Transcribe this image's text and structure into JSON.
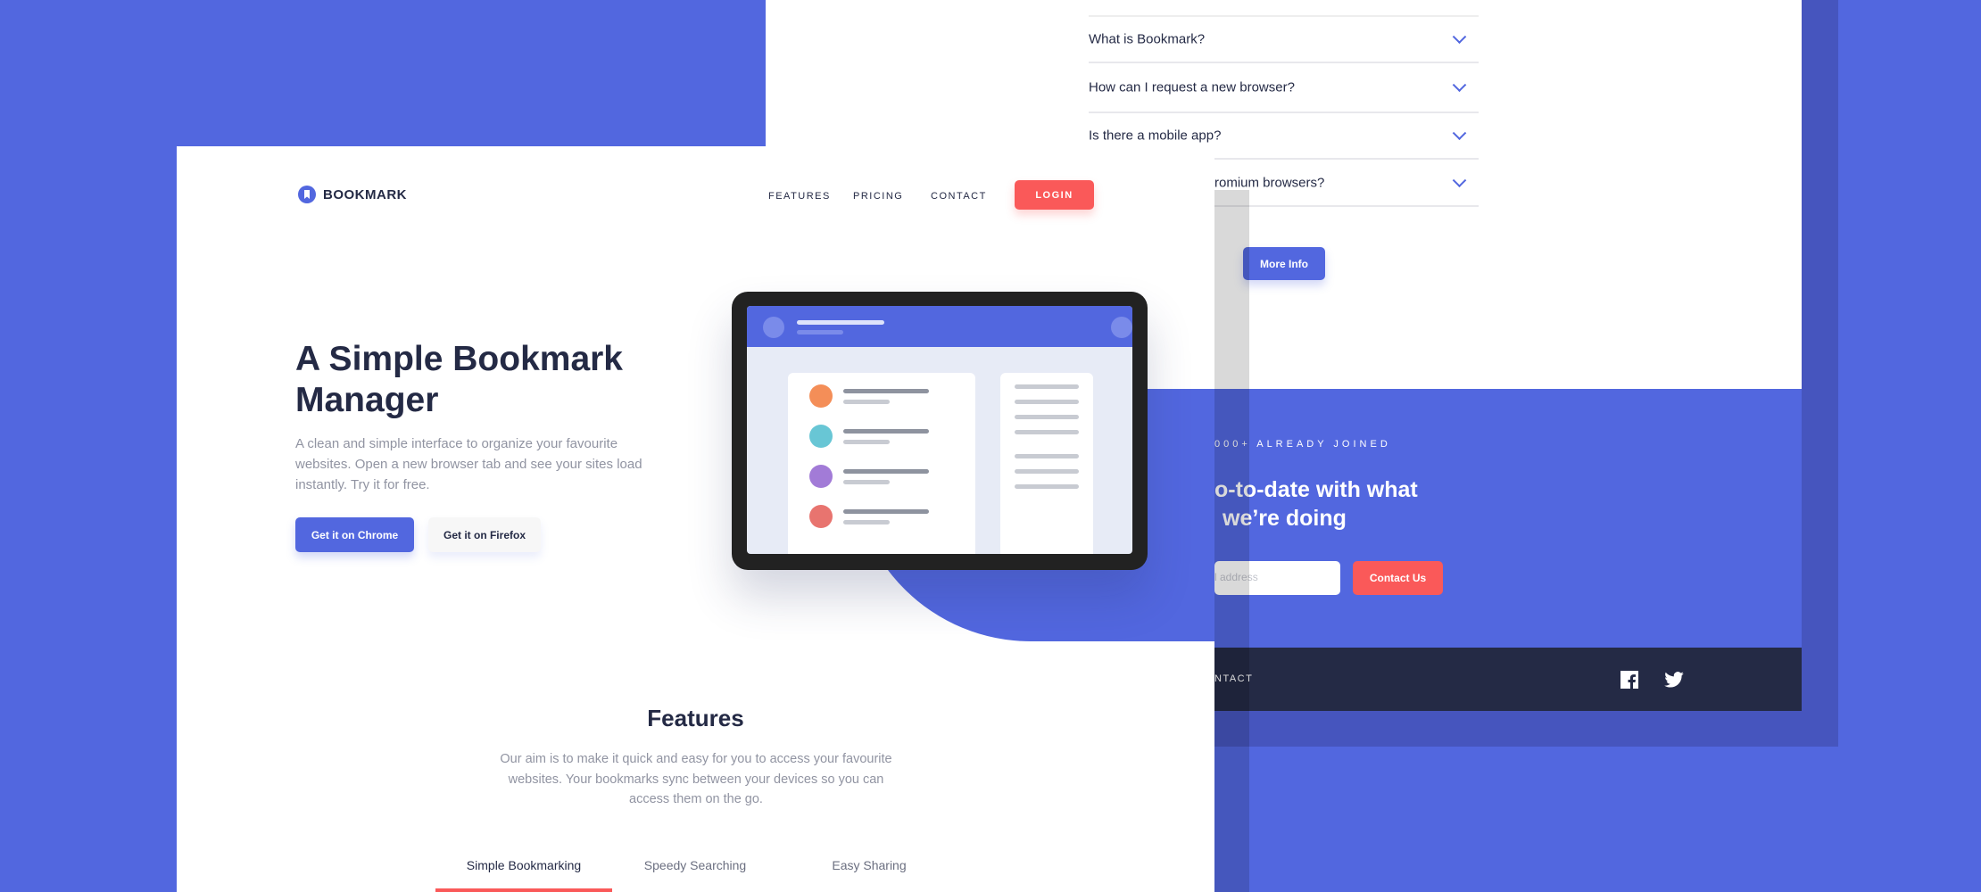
{
  "colors": {
    "primary": "#5267DF",
    "accent": "#FA5959",
    "dark": "#242A45",
    "gray": "#9194A2"
  },
  "faq": {
    "items": [
      {
        "question": "What is Bookmark?"
      },
      {
        "question": "How can I request a new browser?"
      },
      {
        "question": "Is there a mobile app?"
      },
      {
        "question": "romium browsers?"
      }
    ],
    "more_info": "More Info"
  },
  "cta": {
    "joined": "000+ ALREADY JOINED",
    "heading_line1": "o-to-date with what",
    "heading_line2": "we’re doing",
    "email_placeholder": "l address",
    "contact_button": "Contact Us"
  },
  "footer": {
    "contact": "NTACT",
    "icons": [
      "facebook-icon",
      "twitter-icon"
    ]
  },
  "header": {
    "logo": "BOOKMARK",
    "nav": [
      "FEATURES",
      "PRICING",
      "CONTACT"
    ],
    "login": "LOGIN"
  },
  "hero": {
    "title_line1": "A Simple Bookmark",
    "title_line2": "Manager",
    "description": "A clean and simple interface to organize your favourite websites. Open a new browser tab and see your sites load instantly. Try it for free.",
    "chrome_button": "Get it on Chrome",
    "firefox_button": "Get it on Firefox"
  },
  "features": {
    "heading": "Features",
    "description": "Our aim is to make it quick and easy for you to access your favourite websites. Your bookmarks sync between your devices so you can access them on the go.",
    "tabs": [
      "Simple Bookmarking",
      "Speedy Searching",
      "Easy Sharing"
    ],
    "active_tab": 0
  }
}
